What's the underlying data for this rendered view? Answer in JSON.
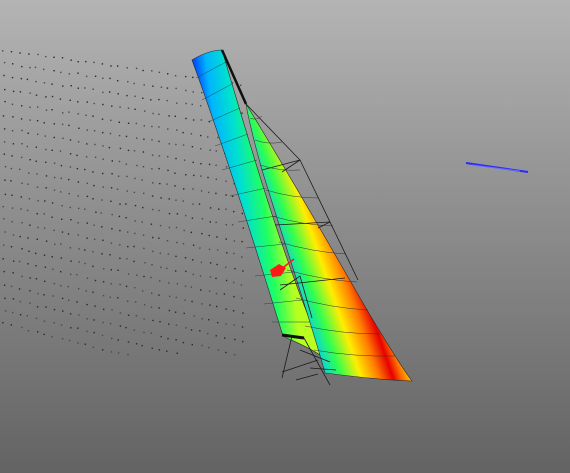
{
  "viewport": {
    "background_top": "#b4b4b4",
    "background_bottom": "#636363"
  },
  "scene": {
    "colormap": [
      "#0000ff",
      "#00c8ff",
      "#00ff66",
      "#ffff00",
      "#ff8800",
      "#ff0000"
    ],
    "mainsail_color_bands": 6,
    "jib_color_bands": 6,
    "flow_marker_color": "#ff1a1a",
    "wind_indicator_color": "#2a2aff",
    "rigging_color": "#1a1a1a"
  }
}
